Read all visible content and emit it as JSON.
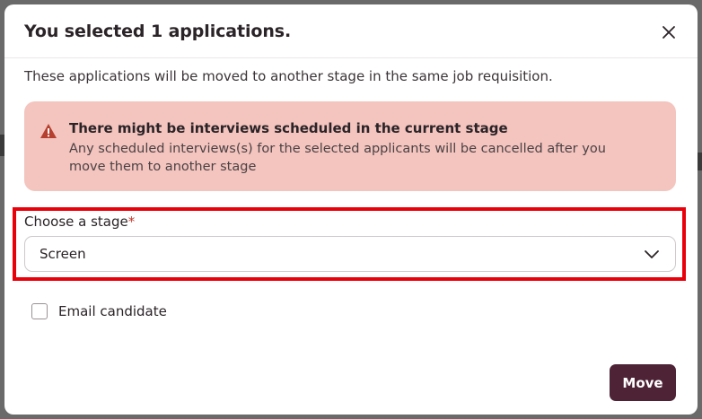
{
  "dialog": {
    "title": "You selected 1 applications.",
    "close_icon": "close-icon",
    "description": "These applications will be moved to another stage in the same job requisition."
  },
  "alert": {
    "icon": "warning-triangle-icon",
    "title": "There might be interviews scheduled in the current stage",
    "body": "Any scheduled interviews(s) for the selected applicants will be cancelled after you move them to another stage"
  },
  "stage_select": {
    "label": "Choose a stage",
    "required_marker": "*",
    "value": "Screen",
    "chevron_icon": "chevron-down-icon"
  },
  "email_candidate": {
    "label": "Email candidate",
    "checked": false
  },
  "actions": {
    "move_label": "Move"
  },
  "colors": {
    "primary": "#4d2335",
    "alert_bg": "#f4c4be",
    "warning_icon": "#b6402f",
    "required": "#c43b2e",
    "highlight": "#e8000b"
  }
}
